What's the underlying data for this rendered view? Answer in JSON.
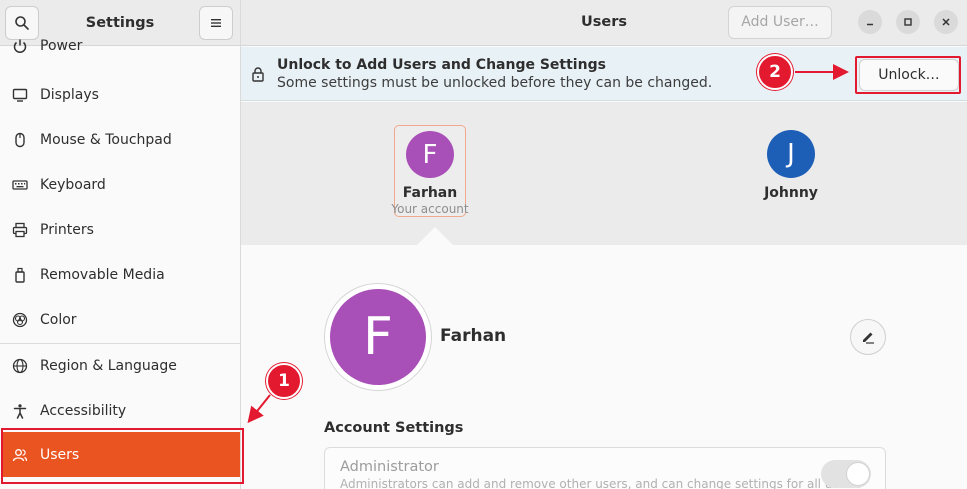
{
  "sidebar": {
    "title": "Settings",
    "items": [
      {
        "label": "Power",
        "icon": "power-icon"
      },
      {
        "label": "Displays",
        "icon": "display-icon"
      },
      {
        "label": "Mouse & Touchpad",
        "icon": "mouse-icon"
      },
      {
        "label": "Keyboard",
        "icon": "keyboard-icon"
      },
      {
        "label": "Printers",
        "icon": "printer-icon"
      },
      {
        "label": "Removable Media",
        "icon": "removable-media-icon"
      },
      {
        "label": "Color",
        "icon": "color-icon"
      },
      {
        "label": "Region & Language",
        "icon": "globe-icon"
      },
      {
        "label": "Accessibility",
        "icon": "accessibility-icon"
      },
      {
        "label": "Users",
        "icon": "users-icon",
        "active": true
      }
    ]
  },
  "header": {
    "title": "Users",
    "add_user_label": "Add User…"
  },
  "infobar": {
    "title": "Unlock to Add Users and Change Settings",
    "subtitle": "Some settings must be unlocked before they can be changed.",
    "unlock_label": "Unlock…"
  },
  "users": [
    {
      "initial": "F",
      "name": "Farhan",
      "subtitle": "Your account",
      "color": "#a94fb8",
      "selected": true
    },
    {
      "initial": "J",
      "name": "Johnny",
      "subtitle": "",
      "color": "#1d5fb7",
      "selected": false
    }
  ],
  "details": {
    "initial": "F",
    "name": "Farhan",
    "account_settings_heading": "Account Settings",
    "administrator_label": "Administrator",
    "administrator_desc": "Administrators can add and remove other users, and can change settings for all users.",
    "administrator_enabled": true
  },
  "annotations": {
    "step1": "1",
    "step2": "2"
  },
  "colors": {
    "accent": "#e95420",
    "annotation_red": "#e3192f"
  }
}
